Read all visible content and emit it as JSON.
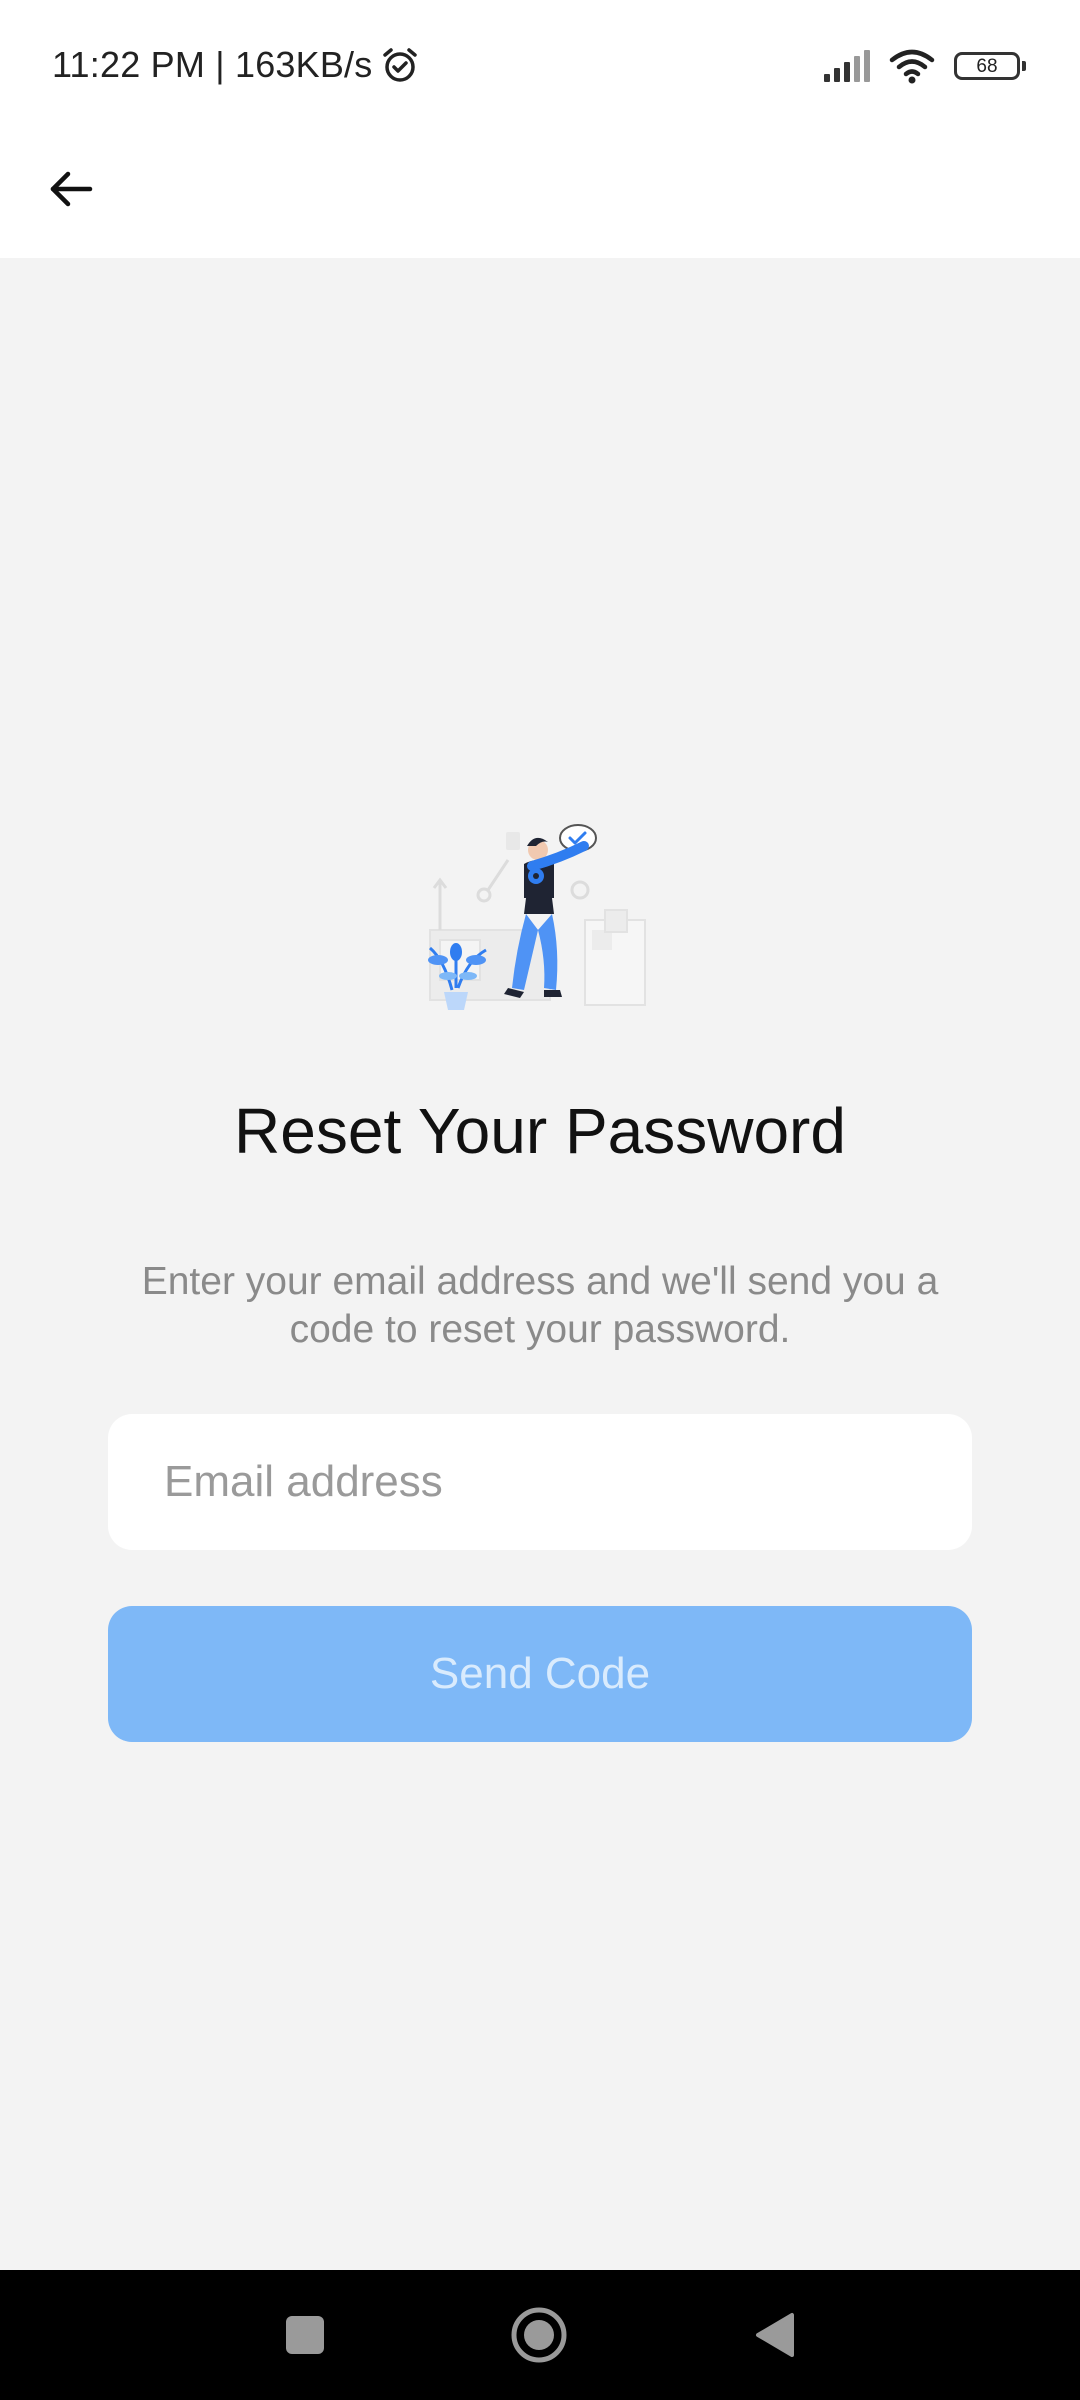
{
  "status_bar": {
    "time_and_speed": "11:22 PM | 163KB/s",
    "battery_level": "68",
    "icons": [
      "alarm-icon",
      "signal-icon",
      "wifi-icon",
      "battery-icon"
    ]
  },
  "header": {
    "back_icon": "arrow-left-icon"
  },
  "main": {
    "title": "Reset Your Password",
    "subtitle": "Enter your email address and we'll send you a code to reset your password.",
    "email_placeholder": "Email address",
    "email_value": "",
    "send_label": "Send Code"
  },
  "nav_bar": {
    "icons": [
      "recent-apps-icon",
      "home-icon",
      "back-icon"
    ]
  },
  "colors": {
    "background": "#f3f3f3",
    "button_disabled": "#7eb8f7",
    "button_text": "#d9ebfd",
    "subtitle": "#8a8a8a",
    "illustration_accent": "#2f7df0"
  }
}
